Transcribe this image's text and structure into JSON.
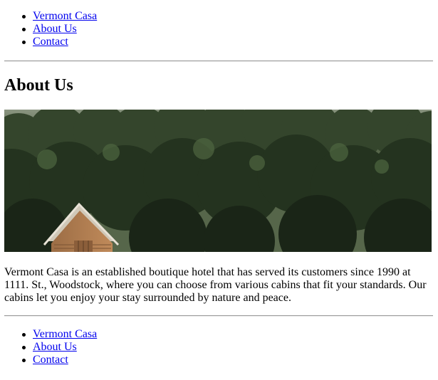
{
  "nav_top": {
    "items": [
      {
        "label": "Vermont Casa"
      },
      {
        "label": "About Us"
      },
      {
        "label": "Contact"
      }
    ]
  },
  "main": {
    "title": "About Us",
    "hero_image": "forest-cabin-photo",
    "intro_text": "Vermont Casa is an established boutique hotel that has served its customers since 1990 at 1111. St., Woodstock, where you can choose from various cabins that fit your standards. Our cabins let you enjoy your stay surrounded by nature and peace."
  },
  "nav_bottom": {
    "items": [
      {
        "label": "Vermont Casa"
      },
      {
        "label": "About Us"
      },
      {
        "label": "Contact"
      }
    ]
  },
  "colors": {
    "link": "#0000ee",
    "text": "#000000",
    "rule": "#9a9a9a"
  }
}
